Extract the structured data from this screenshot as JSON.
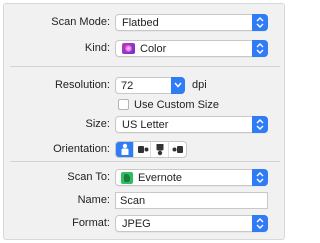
{
  "scan_mode": {
    "label": "Scan Mode:",
    "value": "Flatbed"
  },
  "kind": {
    "label": "Kind:",
    "value": "Color",
    "icon": "color-swatch-icon"
  },
  "resolution": {
    "label": "Resolution:",
    "value": "72",
    "unit": "dpi"
  },
  "custom_size": {
    "label": "Use Custom Size",
    "checked": false
  },
  "size": {
    "label": "Size:",
    "value": "US Letter"
  },
  "orientation": {
    "label": "Orientation:",
    "options": [
      "portrait",
      "landscape-left",
      "portrait-rotated",
      "landscape-right"
    ],
    "selected": "portrait"
  },
  "scan_to": {
    "label": "Scan To:",
    "value": "Evernote",
    "icon": "evernote-icon"
  },
  "name": {
    "label": "Name:",
    "value": "Scan"
  },
  "format": {
    "label": "Format:",
    "value": "JPEG"
  },
  "colors": {
    "accent": "#2f7cf6",
    "panel": "#f1f1f1"
  }
}
